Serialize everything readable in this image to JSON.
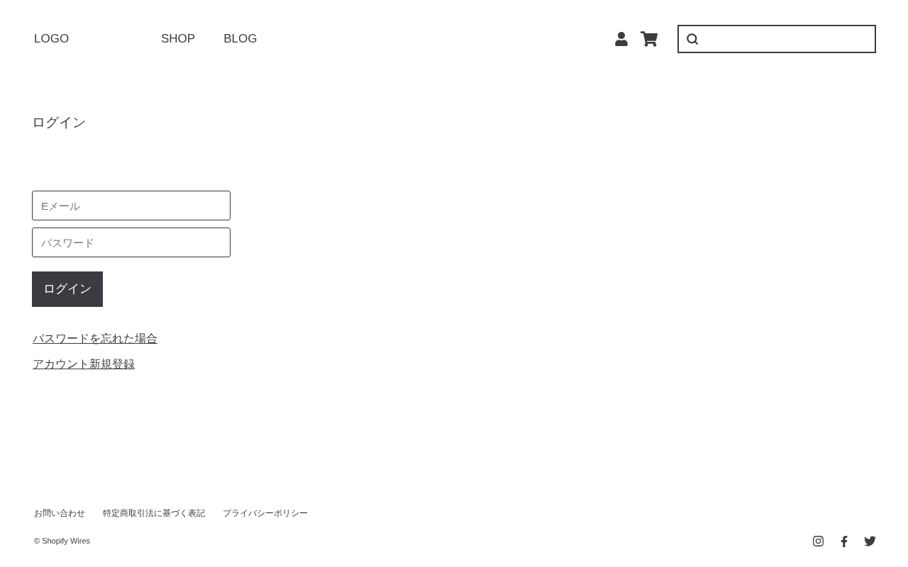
{
  "header": {
    "logo": "LOGO",
    "nav": [
      "SHOP",
      "BLOG"
    ]
  },
  "login": {
    "title": "ログイン",
    "email": {
      "placeholder": "Eメール"
    },
    "password": {
      "placeholder": "パスワード"
    },
    "submit": "ログイン",
    "links": [
      "パスワードを忘れた場合",
      "アカウント新規登録"
    ]
  },
  "footer": {
    "links": [
      "お問い合わせ",
      "特定商取引法に基づく表記",
      "プライバシーポリシー"
    ],
    "copyright": "© Shopify Wires"
  }
}
